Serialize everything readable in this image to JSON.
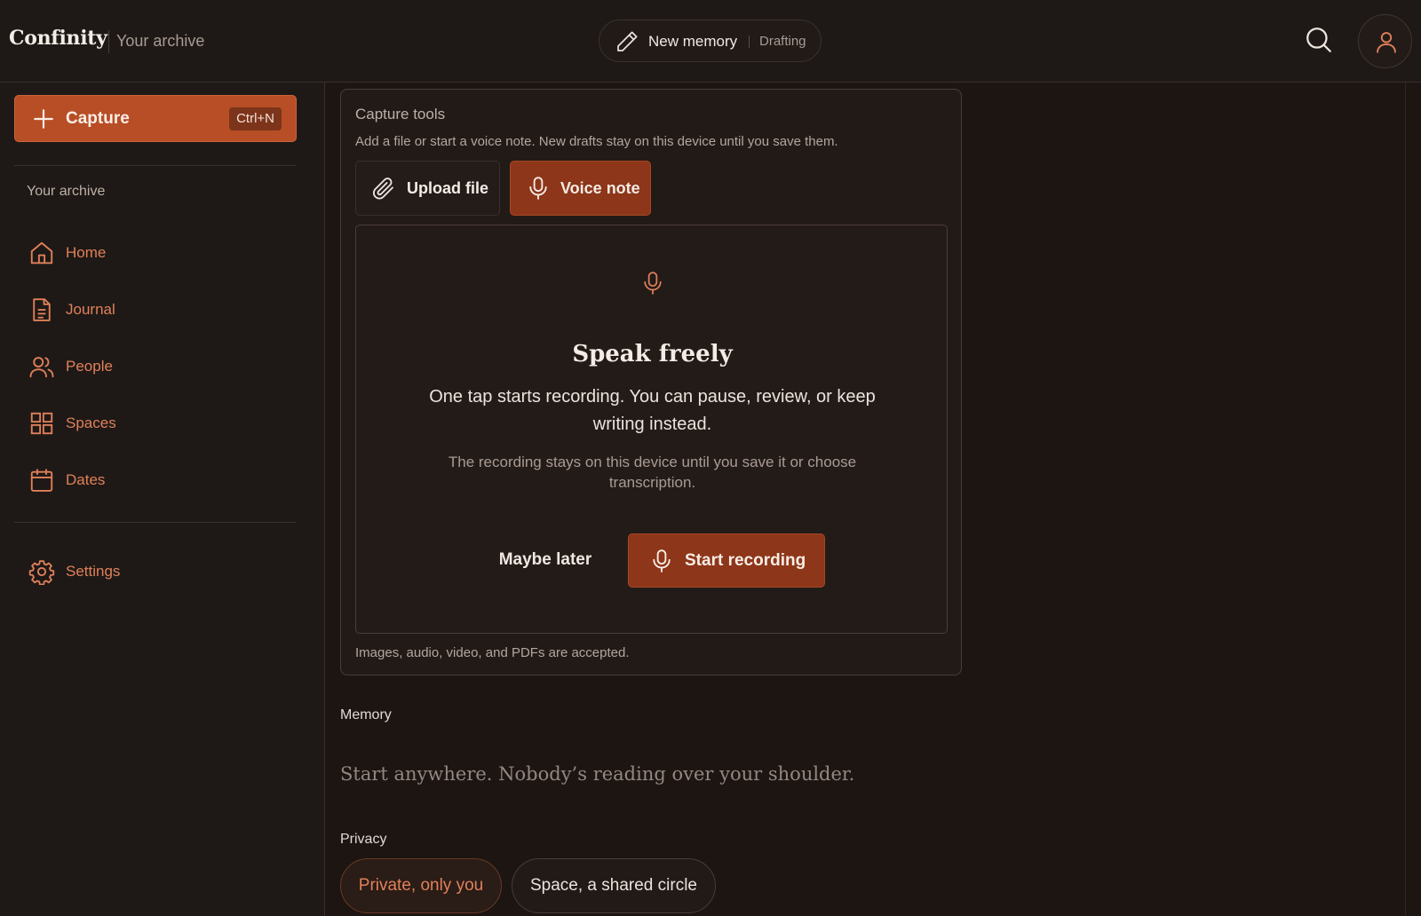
{
  "header": {
    "brand": "Confinity",
    "section": "Your archive",
    "draft_title": "New memory",
    "draft_status": "Drafting"
  },
  "sidebar": {
    "capture_label": "Capture",
    "capture_shortcut": "Ctrl+N",
    "heading": "Your archive",
    "items": [
      {
        "label": "Home",
        "icon": "home-icon"
      },
      {
        "label": "Journal",
        "icon": "document-icon"
      },
      {
        "label": "People",
        "icon": "people-icon"
      },
      {
        "label": "Spaces",
        "icon": "grid-icon"
      },
      {
        "label": "Dates",
        "icon": "calendar-icon"
      }
    ],
    "settings_label": "Settings"
  },
  "capture_tools": {
    "title": "Capture tools",
    "description": "Add a file or start a voice note. New drafts stay on this device until you save them.",
    "upload_label": "Upload file",
    "voice_label": "Voice note",
    "record_title": "Speak freely",
    "record_lead": "One tap starts recording. You can pause, review, or keep writing instead.",
    "record_note": "The recording stays on this device until you save it or choose transcription.",
    "later_label": "Maybe later",
    "start_label": "Start recording",
    "accepted_note": "Images, audio, video, and PDFs are accepted."
  },
  "memory": {
    "label": "Memory",
    "placeholder": "Start anywhere. Nobody’s reading over your shoulder."
  },
  "privacy": {
    "label": "Privacy",
    "options": [
      "Private, only you",
      "Space, a shared circle"
    ],
    "selected": "Private, only you"
  },
  "colors": {
    "accent": "#b74e26",
    "accent_text": "#e0805a",
    "background": "#1c1512"
  }
}
